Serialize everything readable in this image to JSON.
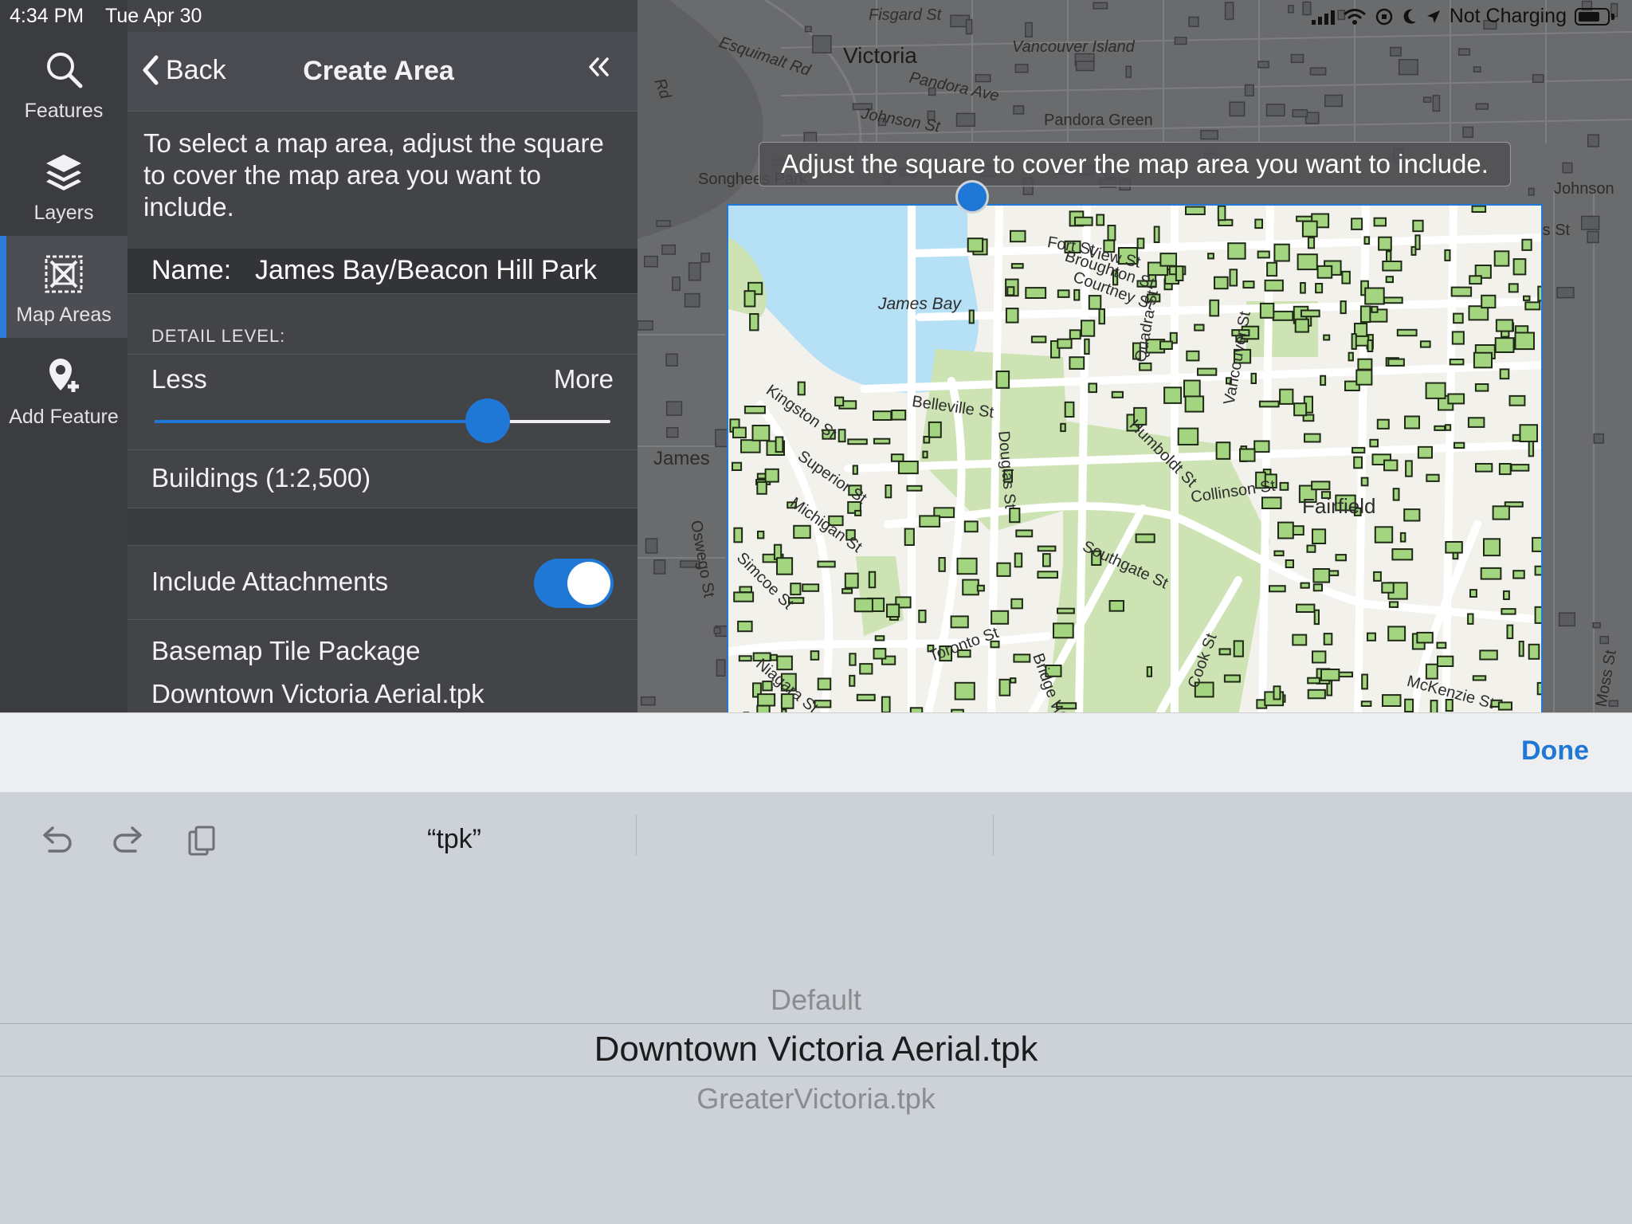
{
  "status": {
    "time": "4:34 PM",
    "date": "Tue Apr 30",
    "charging": "Not Charging"
  },
  "rail": {
    "items": [
      {
        "label": "Features",
        "icon": "search-icon"
      },
      {
        "label": "Layers",
        "icon": "layers-icon"
      },
      {
        "label": "Map Areas",
        "icon": "map-areas-icon",
        "active": true
      },
      {
        "label": "Add Feature",
        "icon": "add-feature-pin-icon"
      }
    ]
  },
  "panel": {
    "back_label": "Back",
    "title": "Create Area",
    "instructions": "To select a map area, adjust the square to cover the map area you want to include.",
    "name_label": "Name:",
    "name_value": "James Bay/Beacon Hill Park",
    "detail_level_header": "DETAIL LEVEL:",
    "slider": {
      "min_label": "Less",
      "max_label": "More",
      "value_fraction": 0.73
    },
    "detail_value": "Buildings (1:2,500)",
    "include_attachments_label": "Include Attachments",
    "include_attachments": true,
    "basemap_label": "Basemap Tile Package",
    "basemap_value": "Downtown Victoria Aerial.tpk"
  },
  "map": {
    "tooltip": "Adjust the square to cover the map area you want to include.",
    "labels": [
      "Victoria",
      "Fisgard St",
      "Esquimalt Rd",
      "Pandora Ave",
      "Johnson St",
      "Pandora Green",
      "Vancouver Island",
      "Songhees Park",
      "View St",
      "Fort St",
      "Broughton St",
      "Courtney St",
      "James Bay",
      "Belleville St",
      "Kingston St",
      "Superior St",
      "Michigan St",
      "Simcoe St",
      "Toronto St",
      "Douglas St",
      "Humboldt St",
      "Fairfield",
      "Collinson St",
      "Southgate St",
      "Bridge W",
      "Cook St",
      "McKenzie St",
      "Quadra St",
      "Vancouver St",
      "Yates St",
      "Johnson",
      "James",
      "Oswego St",
      "Niagara St",
      "Moss St",
      "Rd"
    ],
    "colors": {
      "water": "#b5e0f5",
      "park": "#cde3b3",
      "building": "#a3d47f",
      "land": "#f2f1ec",
      "basemap": "#6a6b6d",
      "accent": "#1f77d6"
    }
  },
  "keyboard": {
    "done_label": "Done",
    "suggestions": [
      "“tpk”",
      "",
      ""
    ],
    "picker": {
      "above": "Default",
      "selected": "Downtown Victoria Aerial.tpk",
      "below": "GreaterVictoria.tpk"
    }
  }
}
